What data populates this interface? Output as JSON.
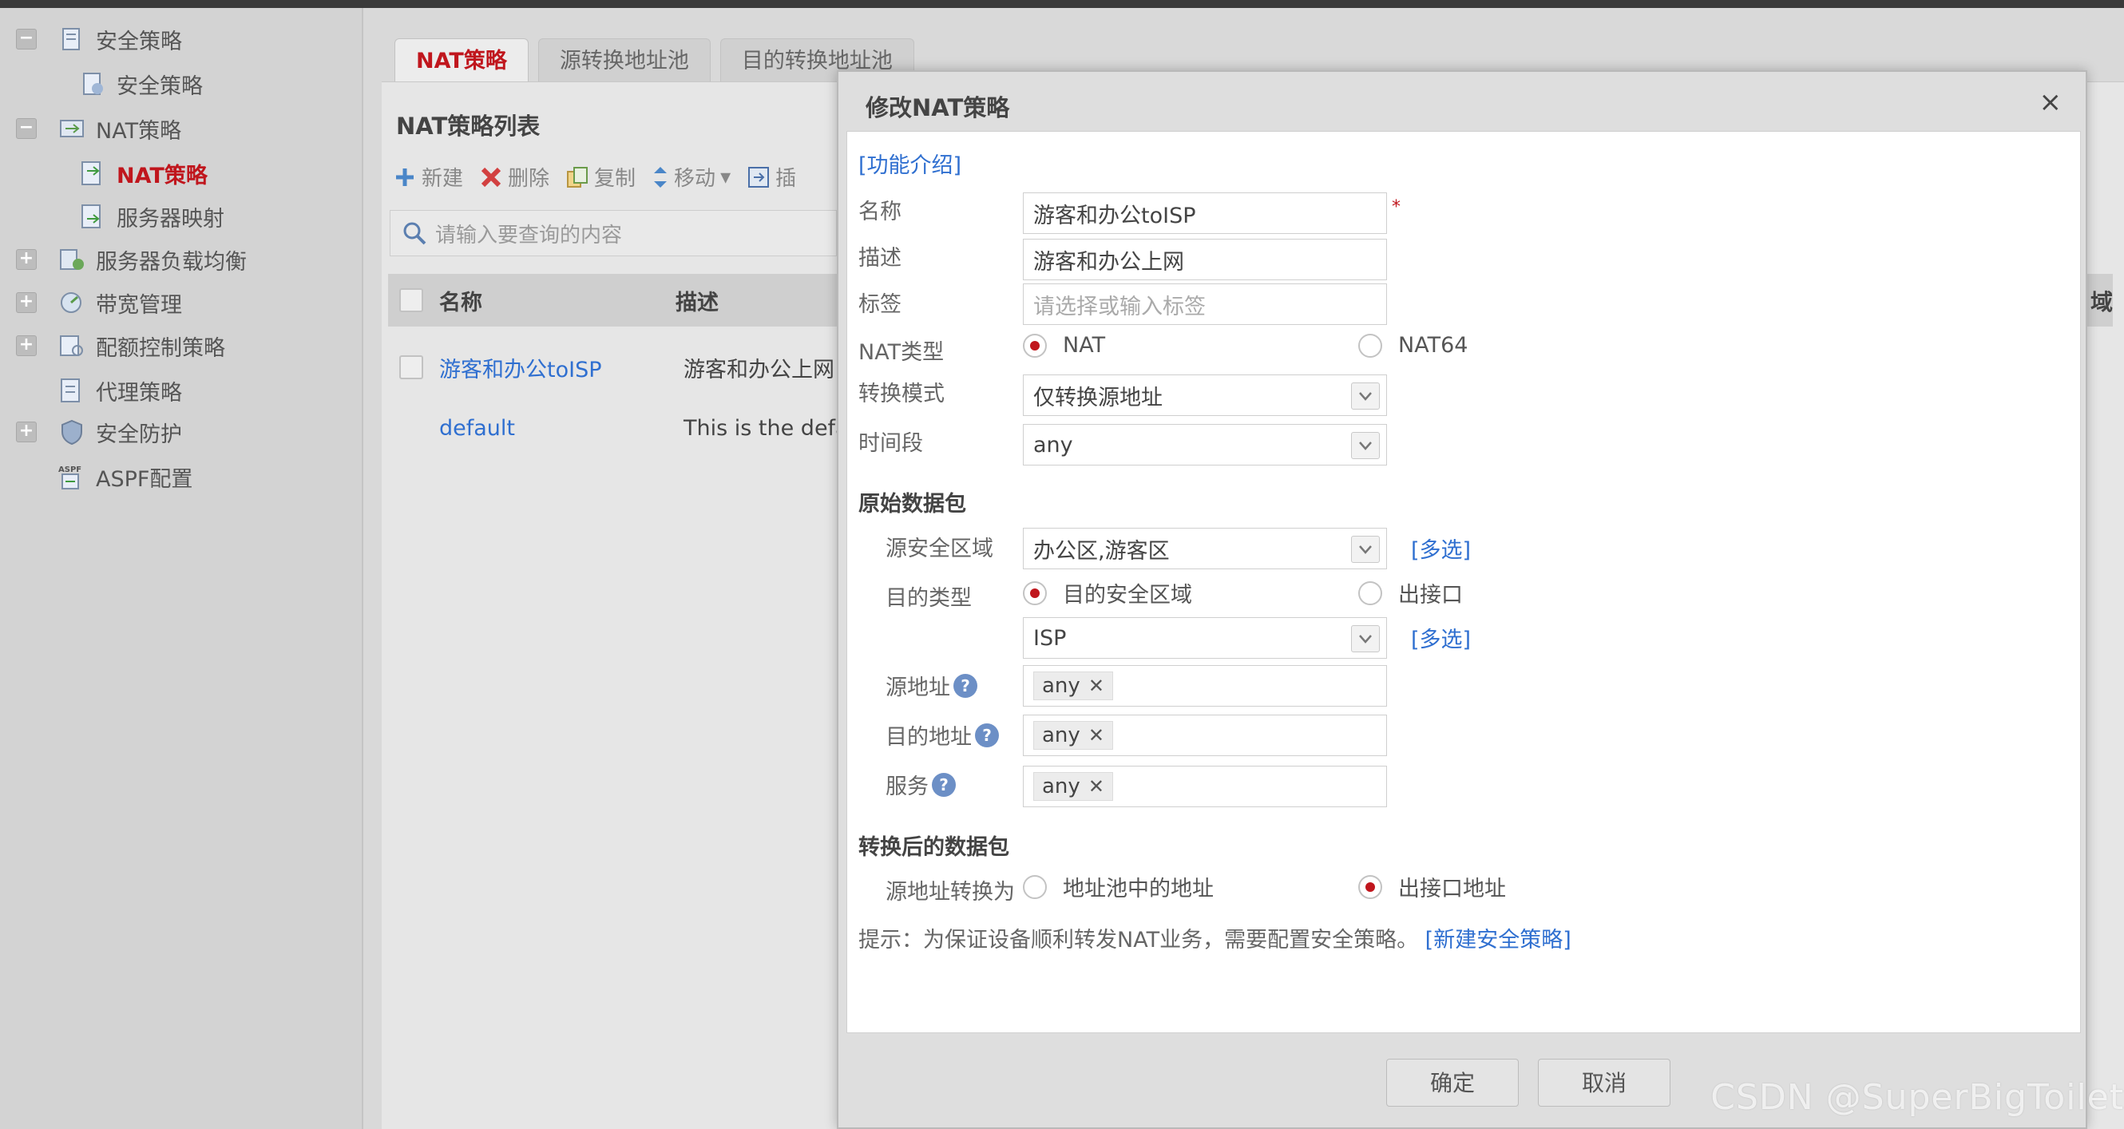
{
  "sidebar": {
    "items": [
      {
        "label": "安全策略",
        "toggle": "−"
      },
      {
        "label": "安全策略"
      },
      {
        "label": "NAT策略",
        "toggle": "−"
      },
      {
        "label": "NAT策略"
      },
      {
        "label": "服务器映射"
      },
      {
        "label": "服务器负载均衡",
        "toggle": "+"
      },
      {
        "label": "带宽管理",
        "toggle": "+"
      },
      {
        "label": "配额控制策略",
        "toggle": "+"
      },
      {
        "label": "代理策略"
      },
      {
        "label": "安全防护",
        "toggle": "+"
      },
      {
        "label": "ASPF配置"
      }
    ]
  },
  "tabs": [
    "NAT策略",
    "源转换地址池",
    "目的转换地址池"
  ],
  "panel": {
    "title": "NAT策略列表",
    "toolbar": {
      "new": "新建",
      "delete": "删除",
      "copy": "复制",
      "move": "移动",
      "insert": "插"
    },
    "search_placeholder": "请输入要查询的内容",
    "columns": [
      "名称",
      "描述"
    ],
    "right_edge_header": "域",
    "rows": [
      {
        "name": "游客和办公toISP",
        "desc": "游客和办公上网"
      },
      {
        "name": "default",
        "desc": "This is the defa"
      }
    ]
  },
  "dialog": {
    "title": "修改NAT策略",
    "close": "×",
    "intro_link": "[功能介绍]",
    "labels": {
      "name": "名称",
      "desc": "描述",
      "tag": "标签",
      "nat_type": "NAT类型",
      "mode": "转换模式",
      "time": "时间段",
      "orig_section": "原始数据包",
      "src_zone": "源安全区域",
      "dst_type": "目的类型",
      "src_addr": "源地址",
      "dst_addr": "目的地址",
      "service": "服务",
      "post_section": "转换后的数据包",
      "src_translate": "源地址转换为"
    },
    "values": {
      "name": "游客和办公toISP",
      "desc": "游客和办公上网",
      "tag_placeholder": "请选择或输入标签",
      "mode": "仅转换源地址",
      "time": "any",
      "src_zone": "办公区,游客区",
      "dst_zone": "ISP",
      "src_addr": "any",
      "dst_addr": "any",
      "service": "any"
    },
    "radios": {
      "nat": "NAT",
      "nat64": "NAT64",
      "dst_zone": "目的安全区域",
      "out_if": "出接口",
      "pool_addr": "地址池中的地址",
      "out_if_addr": "出接口地址"
    },
    "multi_select": "[多选]",
    "hint": "提示：为保证设备顺利转发NAT业务，需要配置安全策略。",
    "hint_link": "[新建安全策略]",
    "ok": "确定",
    "cancel": "取消"
  },
  "watermark": "CSDN @SuperBigToilet"
}
